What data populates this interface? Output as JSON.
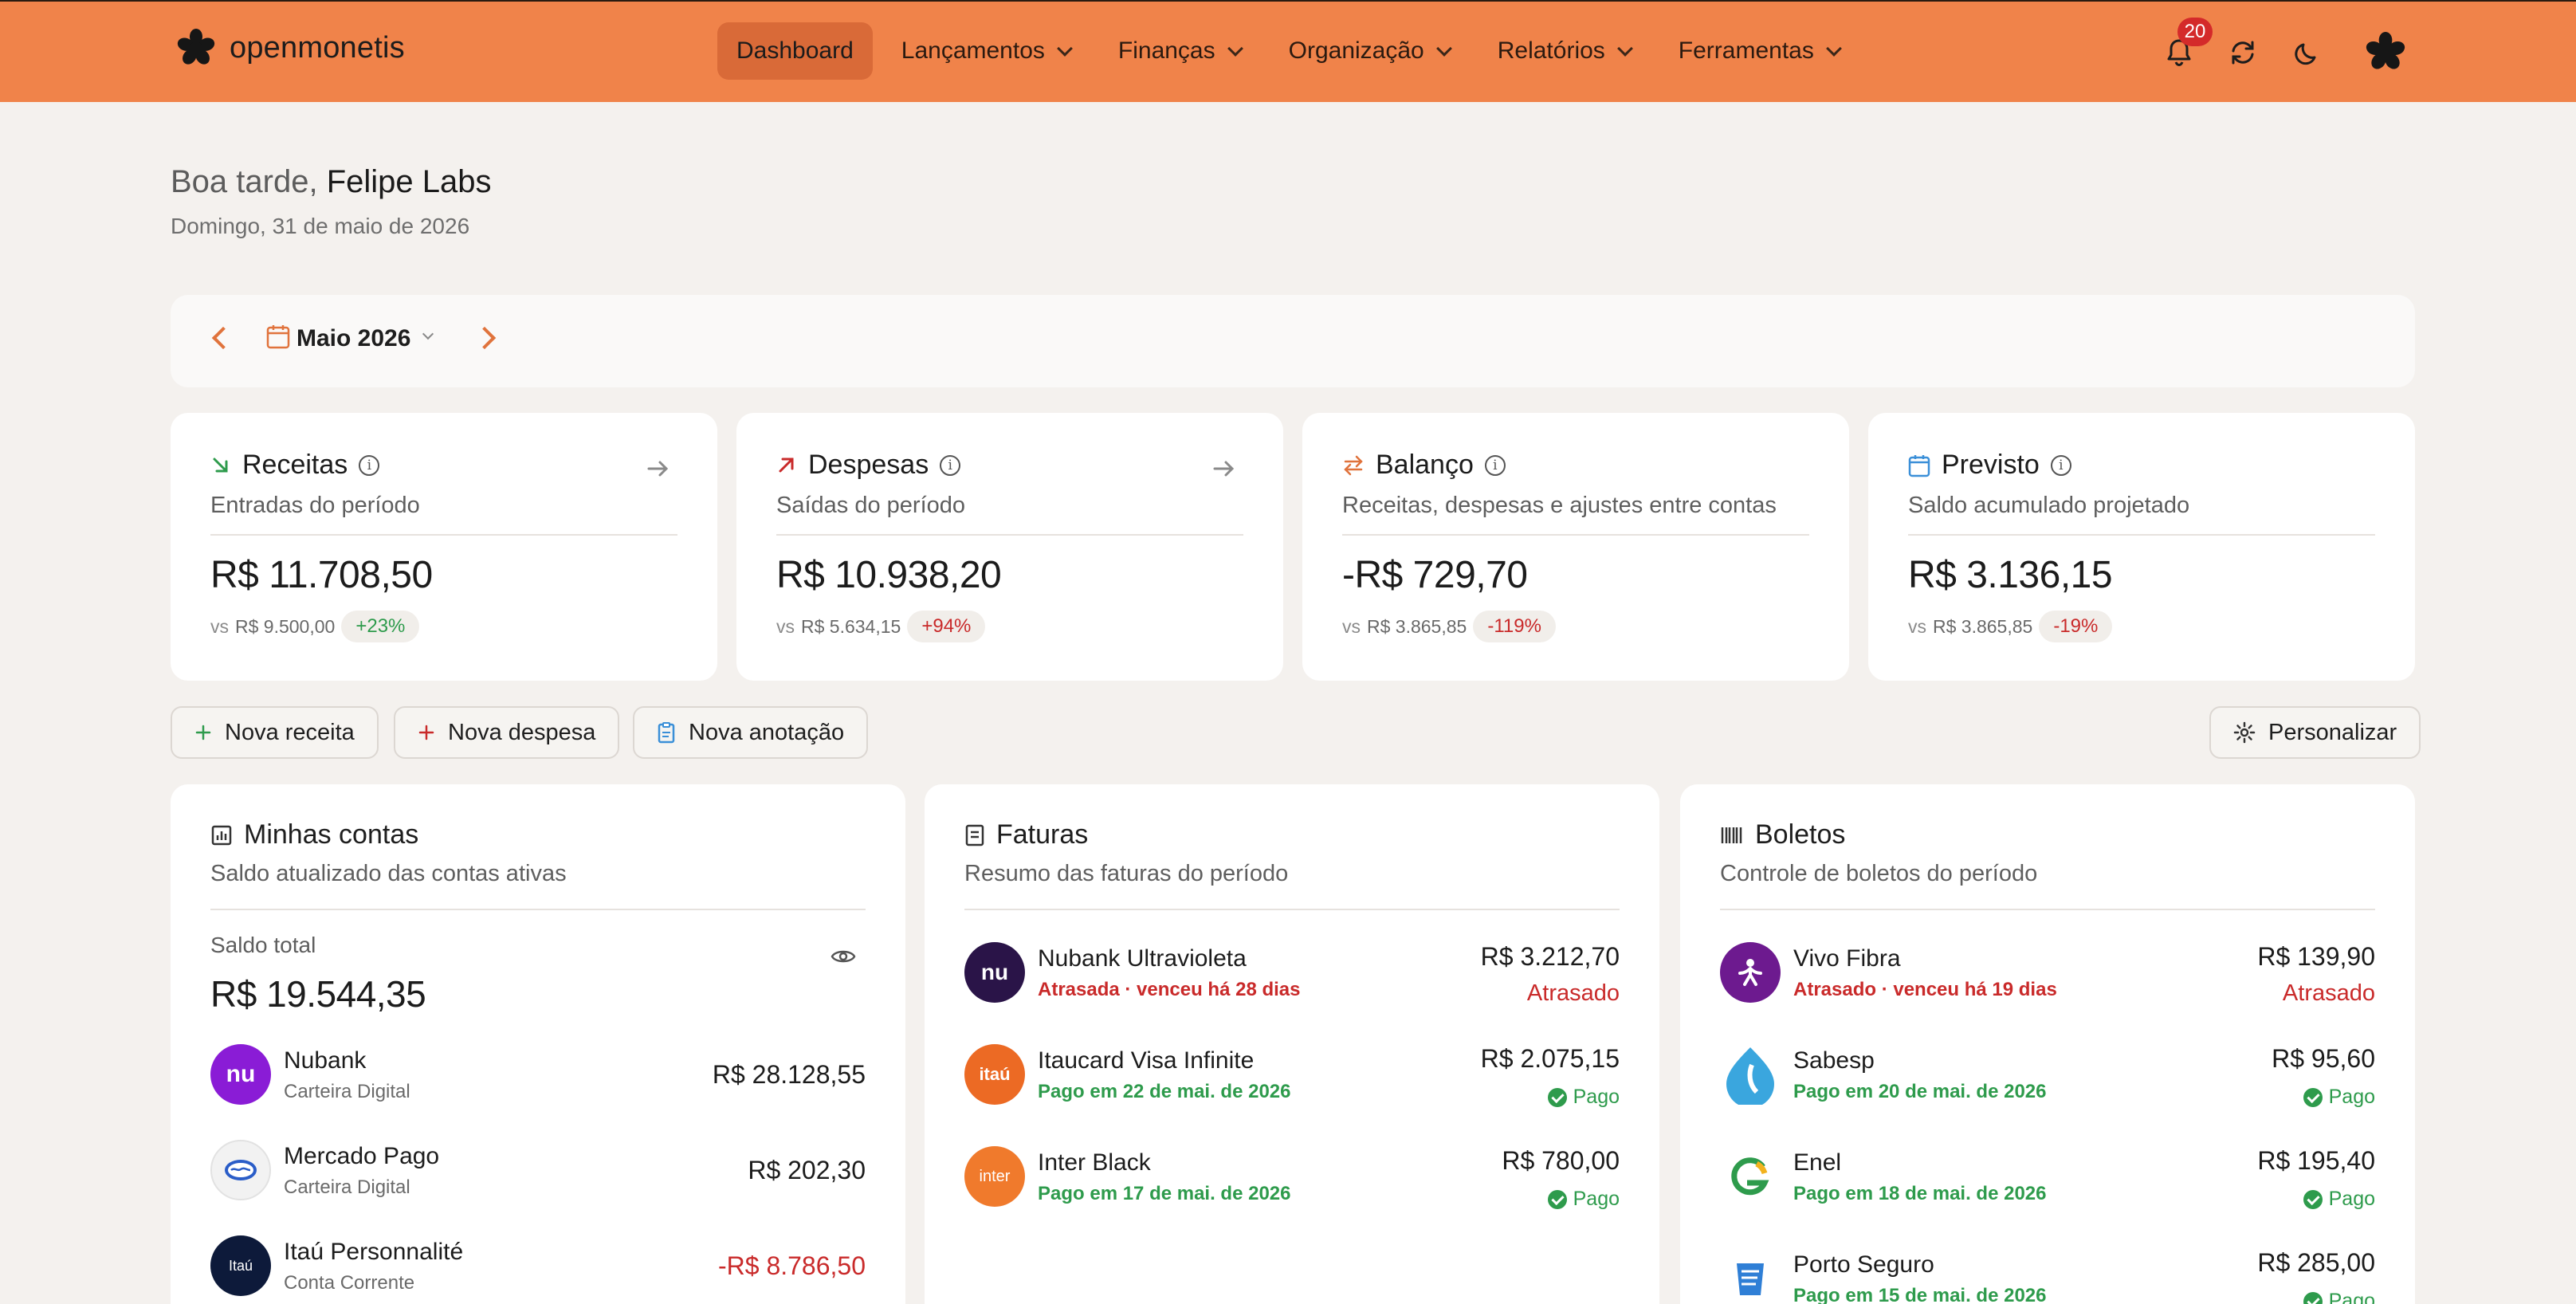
{
  "brand": {
    "name": "openmonetis"
  },
  "nav": {
    "items": [
      {
        "label": "Dashboard",
        "active": true
      },
      {
        "label": "Lançamentos"
      },
      {
        "label": "Finanças"
      },
      {
        "label": "Organização"
      },
      {
        "label": "Relatórios"
      },
      {
        "label": "Ferramentas"
      }
    ],
    "notifications_count": "20"
  },
  "greeting": {
    "prefix": "Boa tarde,",
    "name": "Felipe Labs",
    "date": "Domingo, 31 de maio de 2026"
  },
  "period": {
    "label": "Maio 2026"
  },
  "metrics": [
    {
      "title": "Receitas",
      "subtitle": "Entradas do período",
      "value": "R$ 11.708,50",
      "vs": "vs",
      "ref": "R$ 9.500,00",
      "delta": "+23%"
    },
    {
      "title": "Despesas",
      "subtitle": "Saídas do período",
      "value": "R$ 10.938,20",
      "vs": "vs",
      "ref": "R$ 5.634,15",
      "delta": "+94%"
    },
    {
      "title": "Balanço",
      "subtitle": "Receitas, despesas e ajustes entre contas",
      "value": "-R$ 729,70",
      "vs": "vs",
      "ref": "R$ 3.865,85",
      "delta": "-119%"
    },
    {
      "title": "Previsto",
      "subtitle": "Saldo acumulado projetado",
      "value": "R$ 3.136,15",
      "vs": "vs",
      "ref": "R$ 3.865,85",
      "delta": "-19%"
    }
  ],
  "actions": {
    "new_income": "Nova receita",
    "new_expense": "Nova despesa",
    "new_note": "Nova anotação",
    "customize": "Personalizar"
  },
  "accounts": {
    "title": "Minhas contas",
    "subtitle": "Saldo atualizado das contas ativas",
    "total_label": "Saldo total",
    "total_value": "R$ 19.544,35",
    "items": [
      {
        "name": "Nubank",
        "type": "Carteira Digital",
        "amount": "R$ 28.128,55",
        "logo": "nu",
        "color": "#8a1cd6"
      },
      {
        "name": "Mercado Pago",
        "type": "Carteira Digital",
        "amount": "R$ 202,30",
        "logo": "",
        "color": "#f2f2f2"
      },
      {
        "name": "Itaú Personnalité",
        "type": "Conta Corrente",
        "amount": "-R$ 8.786,50",
        "logo": "Itaú",
        "color": "#0d1a3a"
      }
    ]
  },
  "invoices": {
    "title": "Faturas",
    "subtitle": "Resumo das faturas do período",
    "items": [
      {
        "name": "Nubank Ultravioleta",
        "note": "Atrasada · venceu há 28 dias",
        "amount": "R$ 3.212,70",
        "status": "Atrasado",
        "logo": "nu",
        "color": "#2a1448"
      },
      {
        "name": "Itaucard Visa Infinite",
        "note": "Pago em 22 de mai. de 2026",
        "amount": "R$ 2.075,15",
        "status": "Pago",
        "logo": "itaú",
        "color": "#ec6a24"
      },
      {
        "name": "Inter Black",
        "note": "Pago em 17 de mai. de 2026",
        "amount": "R$ 780,00",
        "status": "Pago",
        "logo": "inter",
        "color": "#f07a2c"
      }
    ]
  },
  "boletos": {
    "title": "Boletos",
    "subtitle": "Controle de boletos do período",
    "items": [
      {
        "name": "Vivo Fibra",
        "note": "Atrasado · venceu há 19 dias",
        "amount": "R$ 139,90",
        "status": "Atrasado",
        "color": "#6d1a8f"
      },
      {
        "name": "Sabesp",
        "note": "Pago em 20 de mai. de 2026",
        "amount": "R$ 95,60",
        "status": "Pago",
        "color": "#3aa6de"
      },
      {
        "name": "Enel",
        "note": "Pago em 18 de mai. de 2026",
        "amount": "R$ 195,40",
        "status": "Pago",
        "color": "#ffffff"
      },
      {
        "name": "Porto Seguro",
        "note": "Pago em 15 de mai. de 2026",
        "amount": "R$ 285,00",
        "status": "Pago",
        "color": "#ffffff"
      }
    ]
  },
  "colors": {
    "nav_bg": "#f0834a",
    "accent": "#e0733c",
    "positive": "#2e9b4c",
    "negative": "#c92a2a"
  }
}
